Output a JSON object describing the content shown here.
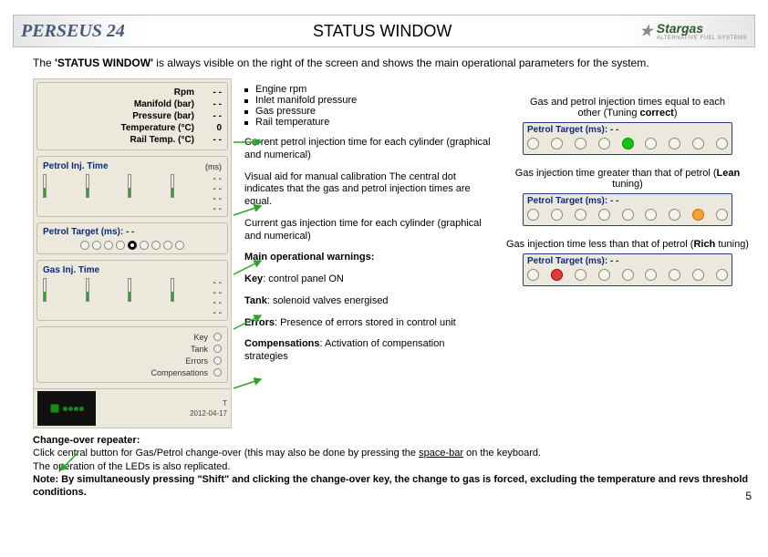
{
  "header": {
    "brand": "PERSEUS 24",
    "title": "STATUS WINDOW",
    "logo_text": "Stargas",
    "logo_sub": "ALTERNATIVE FUEL SYSTEMS"
  },
  "intro": "The 'STATUS WINDOW' is always visible on the right of the screen and shows the main operational parameters for the system.",
  "panel": {
    "params": [
      {
        "label": "Rpm",
        "value": "- -"
      },
      {
        "label": "Manifold (bar)",
        "value": "- -"
      },
      {
        "label": "Pressure (bar)",
        "value": "- -"
      },
      {
        "label": "Temperature (°C)",
        "value": "0"
      },
      {
        "label": "Rail Temp. (°C)",
        "value": "- -"
      }
    ],
    "petrol_inj_title": "Petrol Inj. Time",
    "petrol_inj_ms": "(ms)",
    "petrol_vals": [
      "- -",
      "- -",
      "- -",
      "- -"
    ],
    "petrol_target_title": "Petrol Target (ms):  - -",
    "gas_inj_title": "Gas Inj. Time",
    "gas_vals": [
      "- -",
      "- -",
      "- -",
      "- -"
    ],
    "warnings": [
      "Key",
      "Tank",
      "Errors",
      "Compensations"
    ],
    "clock_t": "T",
    "clock_date": "2012-04-17"
  },
  "mid": {
    "bullets": [
      "Engine rpm",
      "Inlet manifold pressure",
      "Gas pressure",
      "Rail temperature"
    ],
    "p1": "Current petrol injection time for each cylinder (graphical and numerical)",
    "p2": "Visual aid for manual calibration The central dot indicates that the gas and petrol injection times are equal.",
    "p3": "Current gas injection time for each cylinder (graphical and numerical)",
    "main_warn_title": "Main operational warnings:",
    "key_line": {
      "b": "Key",
      "t": ": control panel ON"
    },
    "tank_line": {
      "b": "Tank",
      "t": ": solenoid valves energised"
    },
    "errors_line": {
      "b": "Errors",
      "t": ": Presence of errors stored in control unit"
    },
    "comp_line": {
      "b": "Compensations",
      "t": ": Activation of compensation strategies"
    }
  },
  "right": {
    "cap1a": "Gas and petrol injection times equal to each",
    "cap1b": "other (Tuning correct)",
    "target_label": "Petrol Target (ms):  - -",
    "cap2": "Gas injection time greater than that of petrol (Lean tuning)",
    "cap3": "Gas injection time less than that of petrol (Rich tuning)"
  },
  "foot": {
    "title": "Change-over repeater:",
    "line1a": "Click central button for Gas/Petrol change-over (this may also be done by pressing the ",
    "line1u": "space-bar",
    "line1b": " on the keyboard.",
    "line2": "The operation of the LEDs is also replicated.",
    "note_prefix": "Note: By simultaneously pressing ",
    "note_shift": "\"Shift\"",
    "note_after": " and clicking the change-over key, the change to gas is forced, excluding the temperature and revs threshold conditions."
  },
  "page_number": "5"
}
